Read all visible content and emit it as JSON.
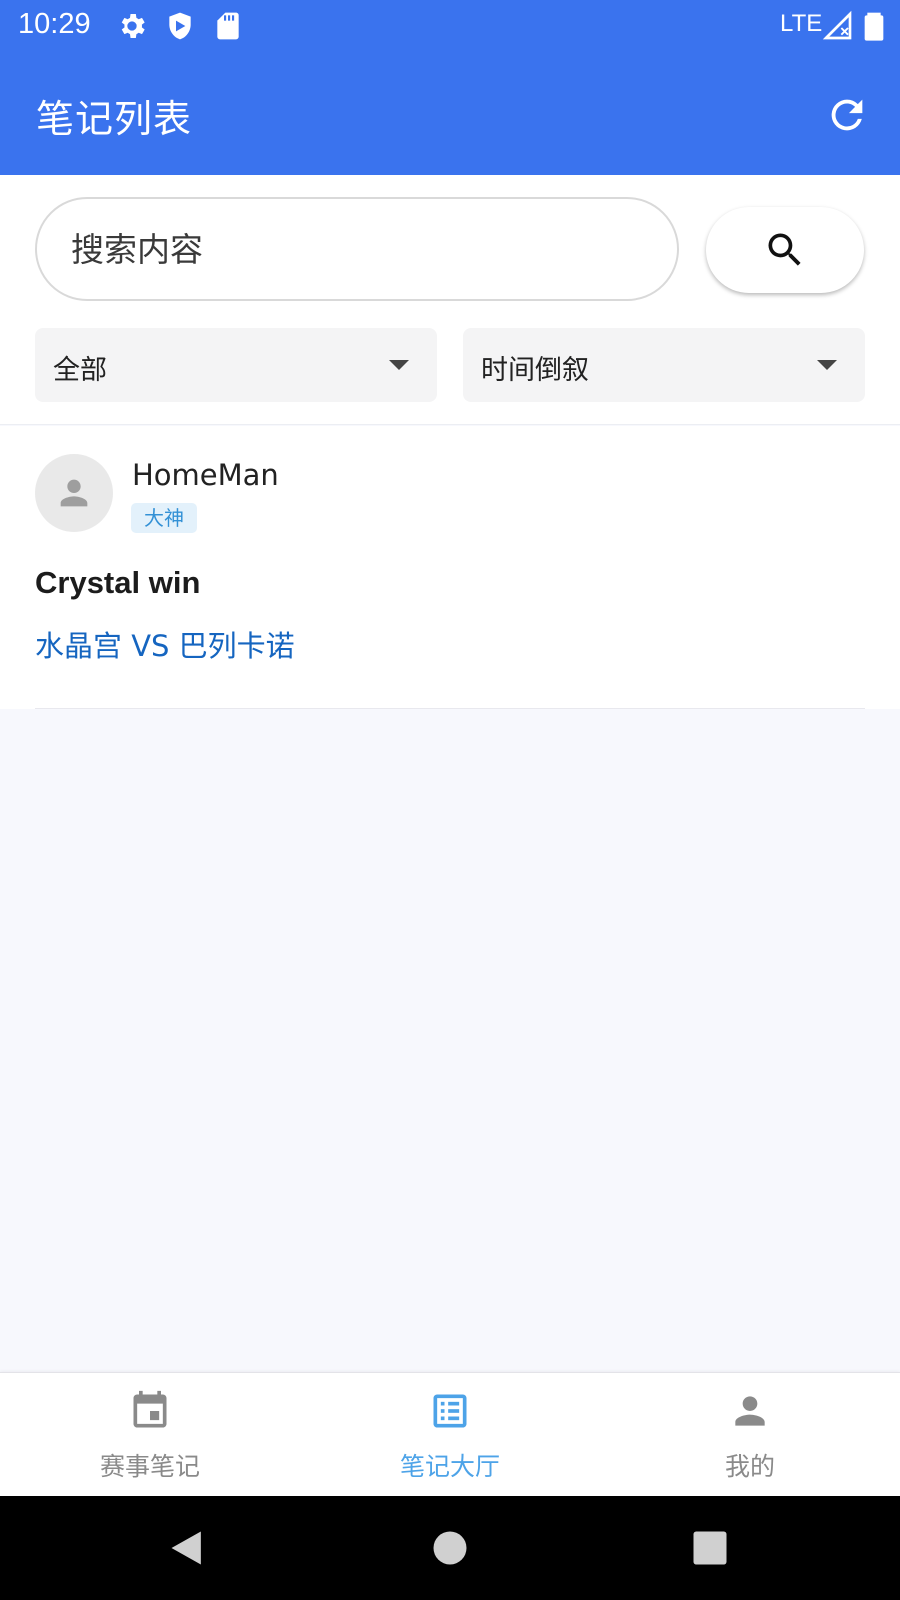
{
  "status_bar": {
    "time": "10:29",
    "network": "LTE",
    "icons": [
      "gear-icon",
      "shield-icon",
      "sd-card-icon",
      "signal-icon",
      "battery-icon"
    ]
  },
  "app_bar": {
    "title": "笔记列表",
    "refresh_icon": "refresh-icon"
  },
  "search": {
    "placeholder": "搜索内容",
    "value": "",
    "button_icon": "search-icon"
  },
  "filters": {
    "category": {
      "selected": "全部"
    },
    "sort": {
      "selected": "时间倒叙"
    }
  },
  "notes": [
    {
      "username": "HomeMan",
      "badge": "大神",
      "title": "Crystal win",
      "match": "水晶宫 VS 巴列卡诺"
    }
  ],
  "bottom_nav": {
    "items": [
      {
        "label": "赛事笔记",
        "icon": "calendar-icon",
        "active": false
      },
      {
        "label": "笔记大厅",
        "icon": "list-icon",
        "active": true
      },
      {
        "label": "我的",
        "icon": "person-icon",
        "active": false
      }
    ]
  },
  "colors": {
    "primary": "#3a73ee",
    "active_nav": "#4da3e8",
    "link": "#1565c0",
    "badge_bg": "#e3f1fb",
    "badge_text": "#3391d6"
  }
}
